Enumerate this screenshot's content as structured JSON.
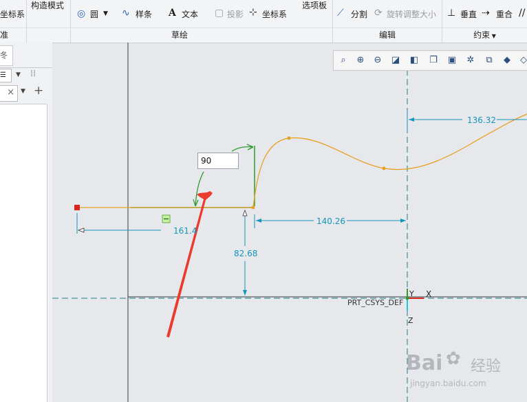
{
  "ribbon": {
    "left_clipped_label": "坐标系",
    "construction_mode": "构造模式",
    "circle": "圆",
    "spline": "样条",
    "text": "文本",
    "project": "投影",
    "coord_sys": "坐标系",
    "palette": "选项板",
    "divide": "分割",
    "rotate_resize": "旋转调整大小",
    "perpendicular": "垂直",
    "coincident": "重合",
    "groups": {
      "datum_clipped": "准",
      "sketch": "草绘",
      "edit": "编辑",
      "constraints": "约束"
    }
  },
  "left_panel": {
    "tab_clipped": "冬"
  },
  "sketch": {
    "angle_value": "90",
    "dim_161": "161.4",
    "dim_140": "140.26",
    "dim_136": "136.32",
    "dim_82": "82.68",
    "csys_label": "PRT_CSYS_DEF",
    "axis_x": "X",
    "axis_y": "Y",
    "axis_z": "Z"
  },
  "watermark": {
    "brand": "Bai",
    "brand_suffix": "经验",
    "url": "jingyan.baidu.com"
  },
  "colors": {
    "spline": "#e8a020",
    "constraint": "#2e9a2e",
    "dimension": "#1496b8",
    "arrow": "#ea3b2e",
    "centerline": "#1a7f8c"
  }
}
